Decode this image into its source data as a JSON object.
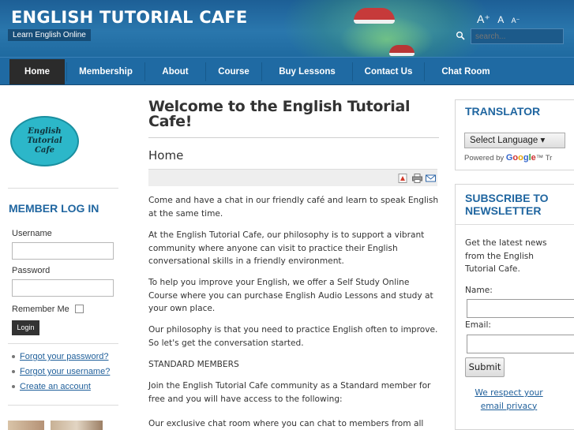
{
  "header": {
    "site_title": "ENGLISH TUTORIAL CAFE",
    "tagline": "Learn English Online",
    "font_sizer": {
      "increase": "A⁺",
      "reset": "A",
      "decrease": "A⁻"
    },
    "search_placeholder": "search...",
    "colors": {
      "header_blue": "#1f6aa3",
      "active_nav": "#2b2b2b"
    }
  },
  "nav": {
    "items": [
      {
        "label": "Home",
        "active": true
      },
      {
        "label": "Membership",
        "active": false
      },
      {
        "label": "About",
        "active": false
      },
      {
        "label": "Course",
        "active": false
      },
      {
        "label": "Buy Lessons",
        "active": false
      },
      {
        "label": "Contact Us",
        "active": false
      },
      {
        "label": "Chat Room",
        "active": false
      }
    ]
  },
  "left": {
    "logo_text": [
      "English",
      "Tutorial",
      "Cafe"
    ],
    "login": {
      "heading": "MEMBER LOG IN",
      "username_label": "Username",
      "password_label": "Password",
      "remember_label": "Remember Me",
      "login_button": "Login",
      "links": [
        "Forgot your password?",
        "Forgot your username?",
        "Create an account"
      ]
    }
  },
  "main": {
    "title": "Welcome to the English Tutorial Cafe!",
    "subtitle": "Home",
    "tool_icons": [
      "pdf-icon",
      "print-icon",
      "email-icon"
    ],
    "paragraphs": [
      "Come and have a chat in our friendly café and learn to speak English at the same time.",
      "At the English Tutorial Cafe, our philosophy is to support a vibrant community where anyone can visit to practice their English conversational skills in a friendly environment.",
      "To help you improve your English, we offer a Self Study Online Course where you can purchase English Audio Lessons and study at your own place.",
      "Our philosophy is that you need to practice English often to improve. So let's get the conversation started.",
      "STANDARD MEMBERS",
      "Join the English Tutorial Cafe community as a Standard member for free and you will have access to the following:",
      "Our exclusive chat room where you can chat to members from all around"
    ]
  },
  "right": {
    "translator": {
      "heading": "TRANSLATOR",
      "select_label": "Select Language",
      "powered_by": "Powered by",
      "brand": "Google",
      "brand_suffix": "™ Tr"
    },
    "newsletter": {
      "heading_line1": "SUBSCRIBE TO",
      "heading_line2": "NEWSLETTER",
      "text": "Get the latest news from the English Tutorial Cafe.",
      "name_label": "Name:",
      "email_label": "Email:",
      "submit_label": "Submit",
      "privacy_line1": "We respect your",
      "privacy_line2": "email privacy"
    }
  }
}
